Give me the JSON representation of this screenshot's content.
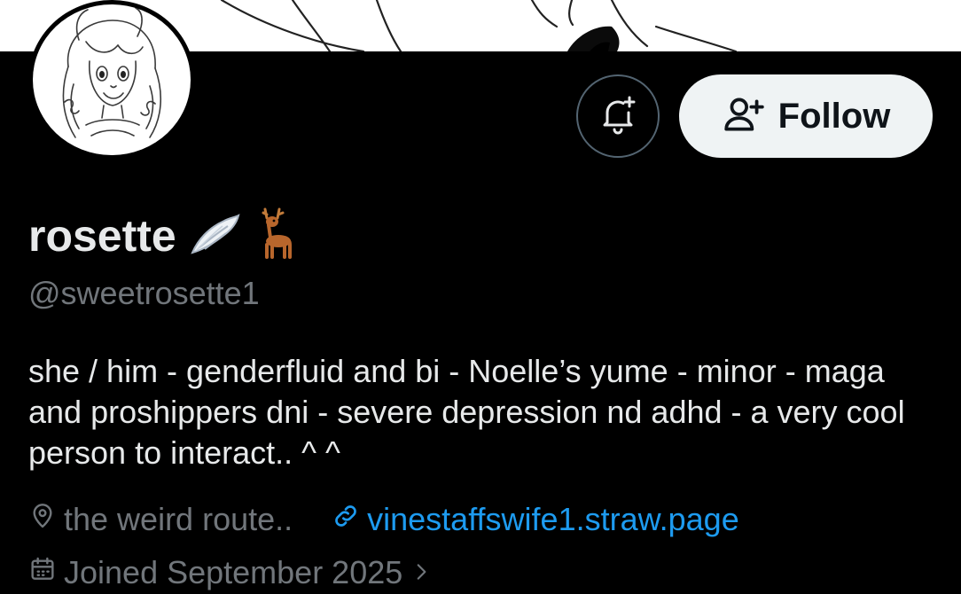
{
  "profile": {
    "display_name": "rosette",
    "handle": "@sweetrosette1",
    "bio": "she / him - genderfluid and bi - Noelle’s yume - minor - maga and proshippers dni - severe depression nd adhd - a very cool person to interact.. ^ ^",
    "location": "the weird route..",
    "website": "vinestaffswife1.straw.page",
    "joined": "Joined September 2025"
  },
  "actions": {
    "follow_label": "Follow",
    "notify_icon": "bell-plus-icon",
    "follow_icon": "person-add-icon"
  },
  "icons": {
    "name_emoji_1": "wing-emoji-icon",
    "name_emoji_2": "deer-emoji-icon",
    "location": "map-pin-icon",
    "website": "link-icon",
    "joined": "calendar-icon",
    "joined_more": "chevron-right-icon"
  },
  "colors": {
    "background": "#000000",
    "text_primary": "#e7e9ea",
    "text_secondary": "#71767b",
    "link": "#1d9bf0",
    "follow_button_bg": "#eff3f4",
    "follow_button_text": "#0f1419",
    "border": "#536471"
  }
}
